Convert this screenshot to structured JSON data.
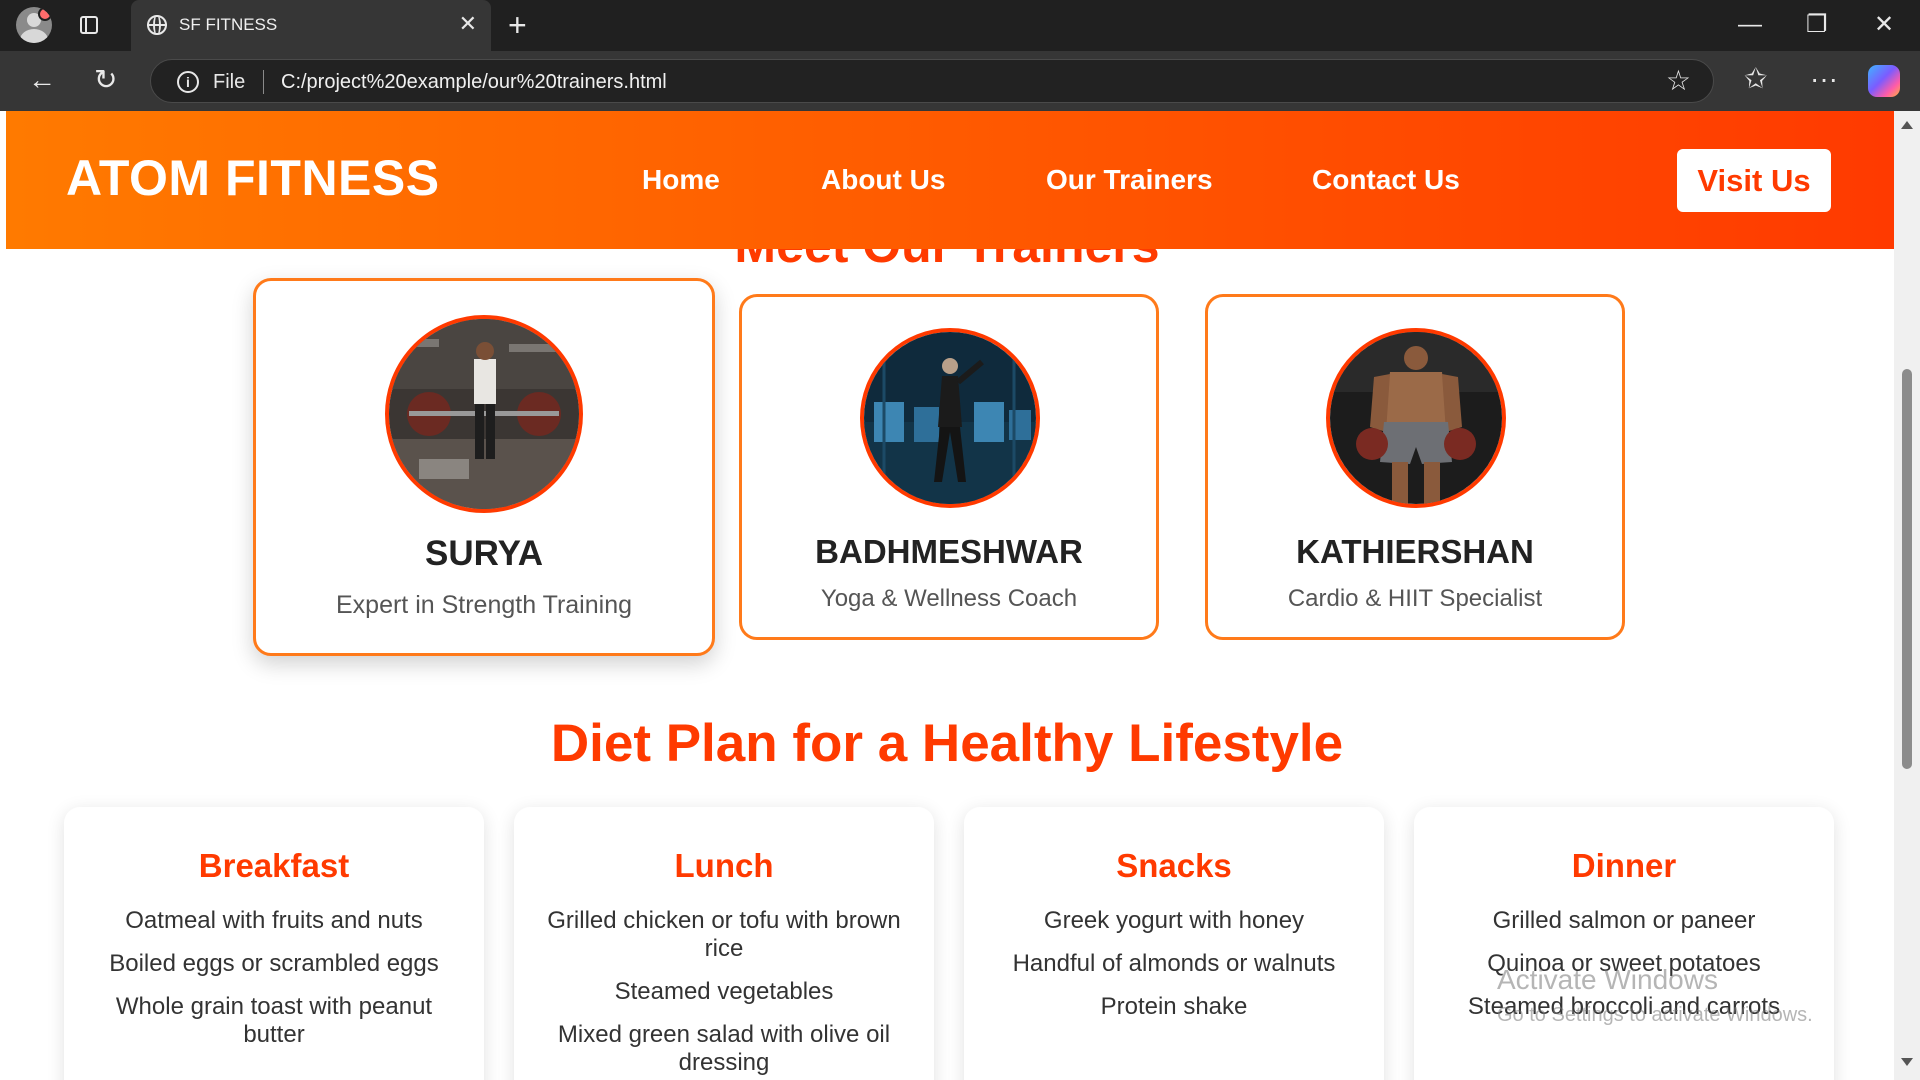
{
  "browser": {
    "tab_title": "SF FITNESS",
    "tab_close": "✕",
    "new_tab": "+",
    "file_label": "File",
    "url": "C:/project%20example/our%20trainers.html",
    "minimize": "—",
    "restore": "❐",
    "close": "✕",
    "back": "←",
    "refresh": "↻",
    "favorite": "☆",
    "favorites": "✩",
    "more": "···",
    "info": "i"
  },
  "site": {
    "brand": "ATOM FITNESS",
    "nav": [
      "Home",
      "About Us",
      "Our Trainers",
      "Contact Us"
    ],
    "cta": "Visit Us",
    "section_title": "Meet Our Trainers"
  },
  "trainers": [
    {
      "name": "SURYA",
      "role": "Expert in Strength Training"
    },
    {
      "name": "BADHMESHWAR",
      "role": "Yoga & Wellness Coach"
    },
    {
      "name": "KATHIERSHAN",
      "role": "Cardio & HIIT Specialist"
    }
  ],
  "diet": {
    "title": "Diet Plan for a Healthy Lifestyle",
    "meals": [
      {
        "name": "Breakfast",
        "items": [
          "Oatmeal with fruits and nuts",
          "Boiled eggs or scrambled eggs",
          "Whole grain toast with peanut butter"
        ]
      },
      {
        "name": "Lunch",
        "items": [
          "Grilled chicken or tofu with brown rice",
          "Steamed vegetables",
          "Mixed green salad with olive oil dressing"
        ]
      },
      {
        "name": "Snacks",
        "items": [
          "Greek yogurt with honey",
          "Handful of almonds or walnuts",
          "Protein shake"
        ]
      },
      {
        "name": "Dinner",
        "items": [
          "Grilled salmon or paneer",
          "Quinoa or sweet potatoes",
          "Steamed broccoli and carrots"
        ]
      }
    ]
  },
  "watermark": {
    "line1": "Activate Windows",
    "line2": "Go to Settings to activate Windows."
  }
}
